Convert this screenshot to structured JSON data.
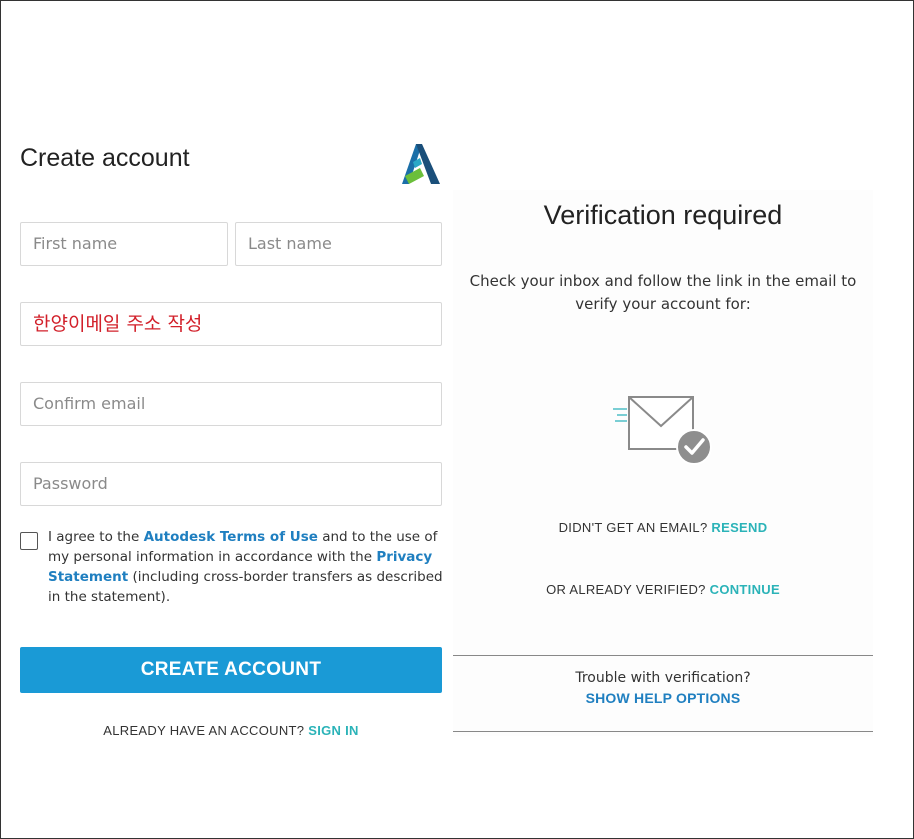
{
  "signup": {
    "title": "Create account",
    "logo_icon": "autodesk-logo-icon",
    "first_name_placeholder": "First name",
    "last_name_placeholder": "Last name",
    "email_value": "한양이메일 주소 작성",
    "confirm_email_placeholder": "Confirm email",
    "password_placeholder": "Password",
    "consent": {
      "part1": "I agree to the ",
      "terms_link": "Autodesk Terms of Use",
      "part2": " and to the use of my personal information in accordance with the ",
      "privacy_link": "Privacy Statement",
      "part3": " (including cross-border transfers as described in the statement)."
    },
    "create_button": "CREATE ACCOUNT",
    "signin_prompt": "ALREADY HAVE AN ACCOUNT? ",
    "signin_link": "SIGN IN"
  },
  "verification": {
    "title": "Verification required",
    "message": "Check your inbox and follow the link in the email to verify your account for:",
    "icon": "email-verified-icon",
    "resend_prompt": "DIDN'T GET AN EMAIL? ",
    "resend_link": "RESEND",
    "continue_prompt": "OR ALREADY VERIFIED? ",
    "continue_link": "CONTINUE",
    "trouble_text": "Trouble with verification?",
    "help_link": "SHOW HELP OPTIONS"
  },
  "colors": {
    "primary_button": "#1a9ad6",
    "link_blue": "#1f7fc0",
    "link_teal": "#2bb3b8",
    "annotation_red": "#d2202a"
  }
}
